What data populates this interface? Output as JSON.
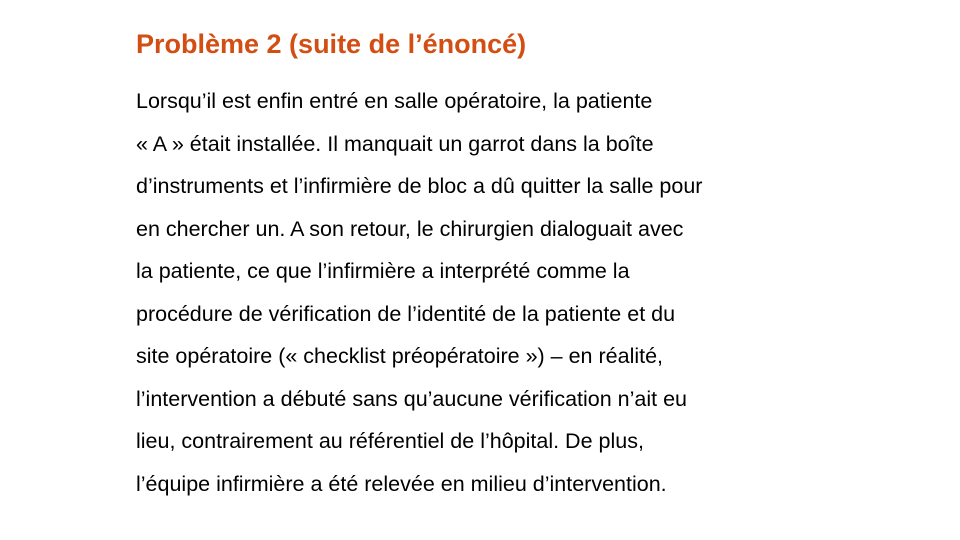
{
  "colors": {
    "title": "#D24E12",
    "text": "#000000",
    "background": "#FFFFFF"
  },
  "slide": {
    "title": "Problème 2 (suite de l’énoncé)",
    "lines": [
      "Lorsqu’il est enfin entré en salle opératoire, la patiente",
      "« A » était installée. Il manquait un garrot dans la boîte",
      "d’instruments et l’infirmière de bloc a dû quitter la salle pour",
      "en chercher un. A son retour, le chirurgien dialoguait avec",
      "la patiente, ce que l’infirmière a interprété comme la",
      "procédure de vérification de l’identité de la patiente et du",
      "site opératoire (« checklist préopératoire ») – en réalité,",
      "l’intervention a débuté sans qu’aucune vérification n’ait eu",
      "lieu, contrairement au référentiel de l’hôpital. De plus,",
      "l’équipe infirmière a été relevée en milieu d’intervention."
    ]
  }
}
